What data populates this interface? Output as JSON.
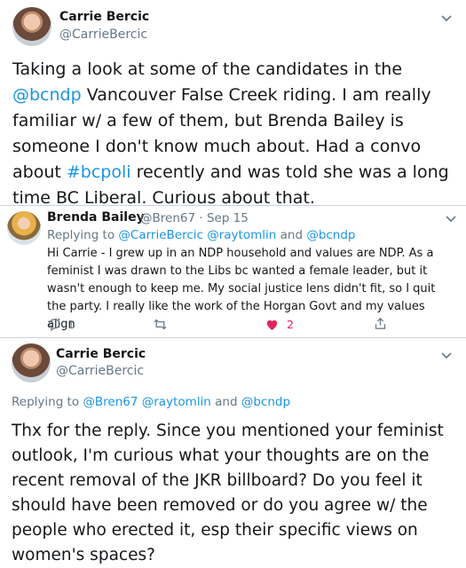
{
  "tweet1": {
    "name": "Carrie Bercic",
    "handle": "@CarrieBercic",
    "text_parts": [
      {
        "t": "Taking a look at some of the candidates in the "
      },
      {
        "t": "@bcndp",
        "link": true
      },
      {
        "t": " Vancouver False Creek riding. I am really familiar w/ a few of them, but Brenda Bailey is someone I don't know much about. Had a convo about "
      },
      {
        "t": "#bcpoli",
        "link": true
      },
      {
        "t": " recently and was told she was a long time BC Liberal. Curious about that."
      }
    ]
  },
  "tweet2": {
    "name": "Brenda Bailey",
    "handle": "@Bren67",
    "date": "· Sep 15",
    "replying_label": "Replying to",
    "replying_handles": "@CarrieBercic @raytomlin",
    "replying_and": "and",
    "replying_last": "@bcndp",
    "text": "Hi Carrie - I grew up in an NDP household and values are NDP. As a feminist I was drawn to the Libs bc wanted a female leader, but it wasn't enough to keep me. My social justice lens didn't fit, so I quit the party. I really like the work of the Horgan Govt and my values align",
    "reply_count": "1",
    "like_count": "2",
    "colors": {
      "like": "#e0245e",
      "icon": "#657786"
    }
  },
  "tweet3": {
    "name": "Carrie Bercic",
    "handle": "@CarrieBercic",
    "replying_label": "Replying to",
    "replying_handles": "@Bren67 @raytomlin",
    "replying_and": "and",
    "replying_last": "@bcndp",
    "text": "Thx for the reply. Since you mentioned your feminist outlook, I'm curious what your thoughts are on the recent removal of the JKR billboard? Do you feel it should have been removed or do you agree w/ the people who erected it, esp their specific views on women's spaces?"
  }
}
